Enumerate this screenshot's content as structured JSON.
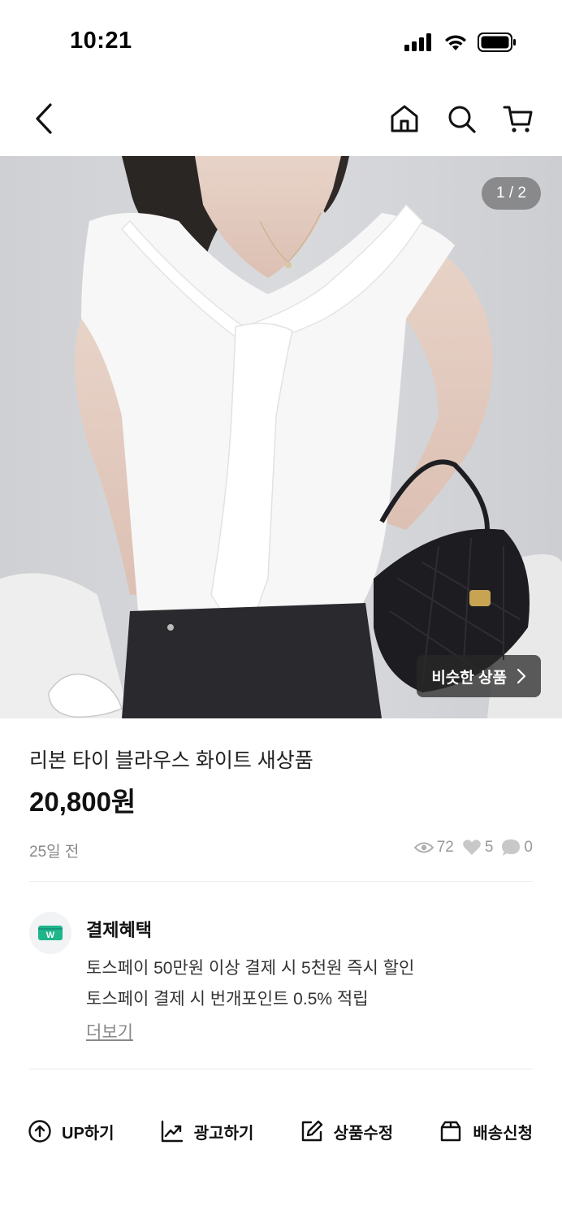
{
  "status_bar": {
    "time": "10:21"
  },
  "nav": {
    "icons": [
      "back-icon",
      "home-icon",
      "search-icon",
      "cart-icon"
    ]
  },
  "gallery": {
    "page_indicator": "1 / 2",
    "similar_label": "비슷한 상품"
  },
  "product": {
    "title": "리본 타이 블라우스 화이트  새상품",
    "price": "20,800원",
    "posted": "25일 전",
    "views": "72",
    "likes": "5",
    "chats": "0"
  },
  "benefit": {
    "title": "결제혜택",
    "lines": [
      "토스페이 50만원 이상 결제 시 5천원 즉시 할인",
      "토스페이 결제 시 번개포인트 0.5% 적립"
    ],
    "more": "더보기",
    "icon_color": "#1fb58a"
  },
  "actions": [
    {
      "label": "UP하기",
      "icon": "up-circle-icon"
    },
    {
      "label": "광고하기",
      "icon": "chart-up-icon"
    },
    {
      "label": "상품수정",
      "icon": "edit-icon"
    },
    {
      "label": "배송신청",
      "icon": "box-icon"
    }
  ]
}
